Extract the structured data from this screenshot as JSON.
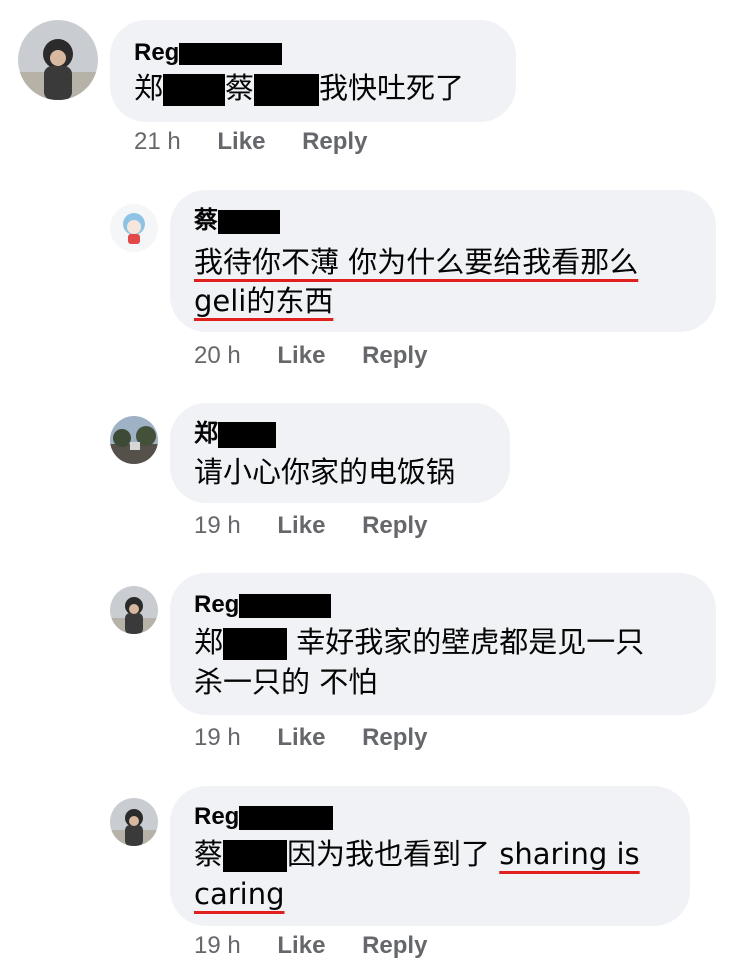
{
  "comments": [
    {
      "author_prefix": "Reg",
      "line1": {
        "p1": "郑",
        "p2": "蔡",
        "p3": "我快吐死了"
      },
      "time": "21 h",
      "like": "Like",
      "reply": "Reply"
    },
    {
      "author_prefix": "蔡",
      "line1": "我待你不薄 你为什么要给我看那么",
      "line2": "geli的东西",
      "time": "20 h",
      "like": "Like",
      "reply": "Reply"
    },
    {
      "author_prefix": "郑",
      "line1": "请小心你家的电饭锅",
      "time": "19 h",
      "like": "Like",
      "reply": "Reply"
    },
    {
      "author_prefix": "Reg",
      "line1": {
        "p1": "郑",
        "p2": " 幸好我家的壁虎都是见一只"
      },
      "line2": "杀一只的 不怕",
      "time": "19 h",
      "like": "Like",
      "reply": "Reply"
    },
    {
      "author_prefix": "Reg",
      "line1": {
        "p1": "蔡",
        "p2": "因为我也看到了 ",
        "p3": "sharing is"
      },
      "line2": "caring",
      "time": "19 h",
      "like": "Like",
      "reply": "Reply"
    }
  ],
  "colors": {
    "bubble": "#f0f2f5",
    "meta": "#65676b",
    "underline": "#e0201c",
    "redaction": "#000000"
  }
}
